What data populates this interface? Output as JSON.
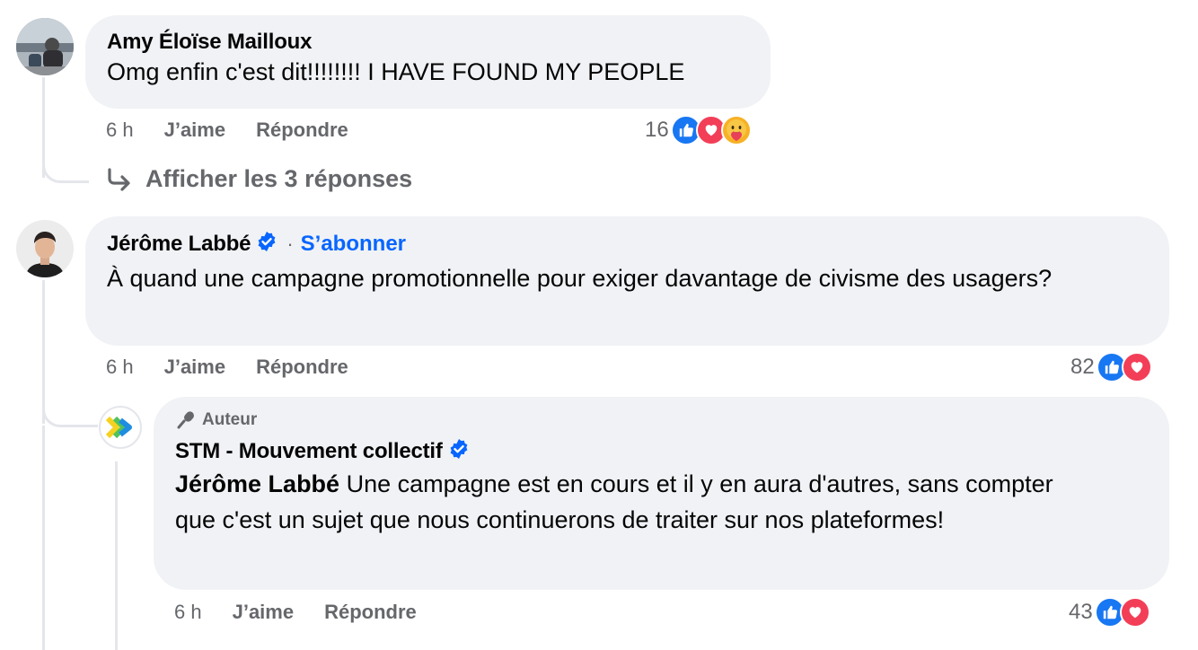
{
  "comments": [
    {
      "author": "Amy Éloïse Mailloux",
      "text": "Omg enfin c'est dit!!!!!!!! I HAVE FOUND MY PEOPLE",
      "time": "6 h",
      "like_label": "J’aime",
      "reply_label": "Répondre",
      "reaction_count": "16",
      "reactions": [
        "like-icon",
        "love-icon",
        "care-icon"
      ],
      "view_replies_label": "Afficher les 3 réponses"
    },
    {
      "author": "Jérôme Labbé",
      "verified": true,
      "separator": "·",
      "follow_label": "S’abonner",
      "text": "À quand une campagne promotionnelle pour exiger davantage de civisme des usagers?",
      "time": "6 h",
      "like_label": "J’aime",
      "reply_label": "Répondre",
      "reaction_count": "82",
      "reactions": [
        "like-icon",
        "love-icon"
      ]
    }
  ],
  "reply": {
    "badge_label": "Auteur",
    "author": "STM - Mouvement collectif",
    "verified": true,
    "mention": "Jérôme Labbé",
    "text": " Une campagne est en cours et il y en aura d'autres, sans compter que c'est un sujet que nous continuerons de traiter sur nos plateformes!",
    "time": "6 h",
    "like_label": "J’aime",
    "reply_label": "Répondre",
    "reaction_count": "43",
    "reactions": [
      "like-icon",
      "love-icon"
    ]
  },
  "colors": {
    "bubble": "#f0f2f5",
    "secondary_text": "#65676b",
    "link": "#0866ff",
    "like": "#1877f2",
    "love": "#f33e58"
  }
}
